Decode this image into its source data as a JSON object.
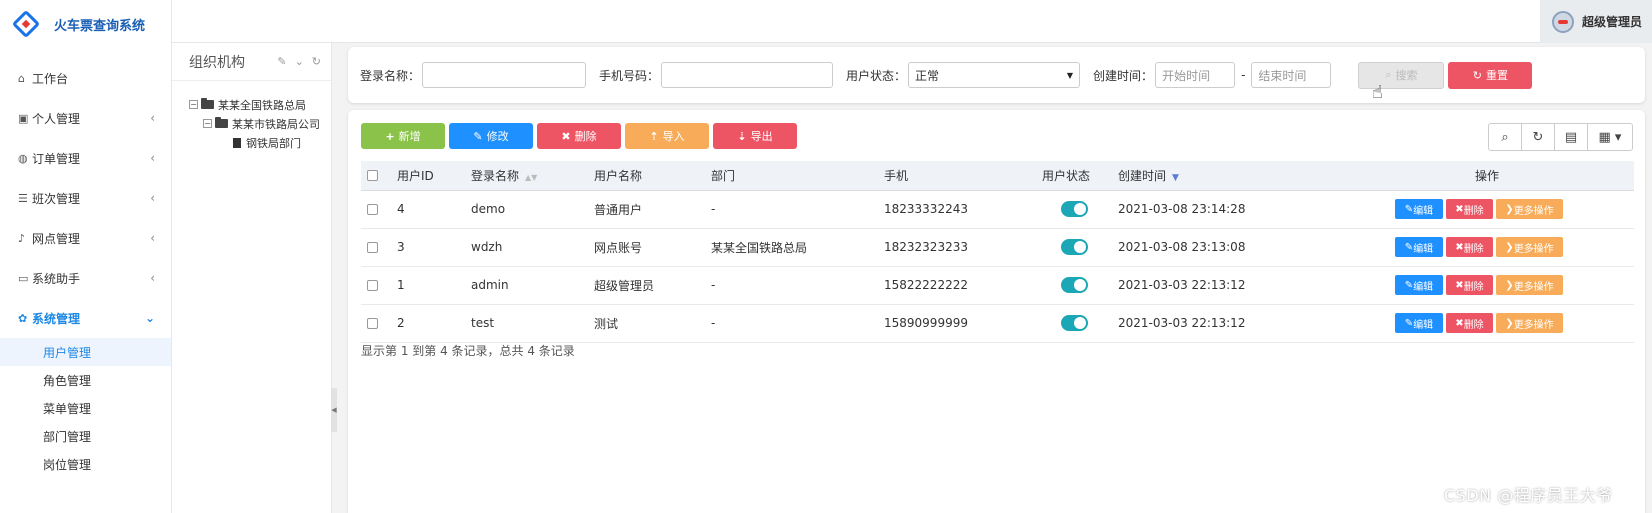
{
  "brand": {
    "title": "火车票查询系统"
  },
  "sidebar": {
    "items": [
      {
        "icon": "home-icon",
        "label": "工作台",
        "has_arrow": false
      },
      {
        "icon": "id-card-icon",
        "label": "个人管理",
        "has_arrow": true
      },
      {
        "icon": "order-icon",
        "label": "订单管理",
        "has_arrow": true
      },
      {
        "icon": "list-icon",
        "label": "班次管理",
        "has_arrow": true
      },
      {
        "icon": "bell-icon",
        "label": "网点管理",
        "has_arrow": true
      },
      {
        "icon": "laptop-icon",
        "label": "系统助手",
        "has_arrow": true
      },
      {
        "icon": "gear-icon",
        "label": "系统管理",
        "has_arrow": true,
        "active": true
      }
    ],
    "sub_items": [
      "用户管理",
      "角色管理",
      "菜单管理",
      "部门管理",
      "岗位管理"
    ],
    "active_sub": "用户管理"
  },
  "topbar": {
    "user_name": "超级管理员"
  },
  "org": {
    "title": "组织机构",
    "tree": [
      {
        "label": "某某全国铁路总局",
        "level": 0,
        "type": "folder"
      },
      {
        "label": "某某市铁路局公司",
        "level": 1,
        "type": "folder"
      },
      {
        "label": "钢铁局部门",
        "level": 2,
        "type": "file"
      }
    ]
  },
  "search": {
    "login_name_label": "登录名称：",
    "login_name_value": "",
    "phone_label": "手机号码：",
    "phone_value": "",
    "status_label": "用户状态：",
    "status_value": "正常",
    "created_label": "创建时间：",
    "start_placeholder": "开始时间",
    "end_placeholder": "结束时间",
    "search_button": "搜索",
    "reset_button": "重置"
  },
  "toolbar": {
    "add": "新增",
    "edit": "修改",
    "delete": "删除",
    "import": "导入",
    "export": "导出"
  },
  "table": {
    "columns": [
      "用户ID",
      "登录名称",
      "用户名称",
      "部门",
      "手机",
      "用户状态",
      "创建时间",
      "操作"
    ],
    "rows": [
      {
        "id": "4",
        "login": "demo",
        "name": "普通用户",
        "dept": "-",
        "phone": "18233332243",
        "status_on": true,
        "created": "2021-03-08 23:14:28"
      },
      {
        "id": "3",
        "login": "wdzh",
        "name": "网点账号",
        "dept": "某某全国铁路总局",
        "phone": "18232323233",
        "status_on": true,
        "created": "2021-03-08 23:13:08"
      },
      {
        "id": "1",
        "login": "admin",
        "name": "超级管理员",
        "dept": "-",
        "phone": "15822222222",
        "status_on": true,
        "created": "2021-03-03 22:13:12"
      },
      {
        "id": "2",
        "login": "test",
        "name": "测试",
        "dept": "-",
        "phone": "15890999999",
        "status_on": true,
        "created": "2021-03-03 22:13:12"
      }
    ],
    "row_actions": {
      "edit": "编辑",
      "delete": "删除",
      "more": "更多操作"
    },
    "footer": "显示第 1 到第 4 条记录，总共 4 条记录"
  },
  "watermark": "CSDN @程序员王大爷",
  "colors": {
    "primary": "#1e90ff",
    "danger": "#ed5565",
    "warning": "#f8ac59",
    "success": "#8bc34a",
    "toggle": "#1ba7b5"
  }
}
